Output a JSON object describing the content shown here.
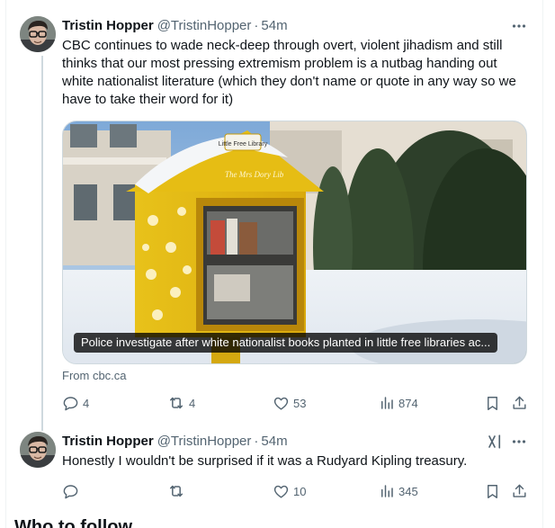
{
  "tweets": [
    {
      "name": "Tristin Hopper",
      "handle": "@TristinHopper",
      "separator": "·",
      "time": "54m",
      "text": "CBC continues to wade neck-deep through overt, violent jihadism and still thinks that our most pressing extremism problem is a nutbag handing out white nationalist literature (which they don't name or quote in any way so we have to take their word for it)",
      "card": {
        "caption": "Police investigate after white nationalist books planted in little free libraries ac...",
        "sign_text": "Little Free Library",
        "box_text": "The Mrs Dory Lib",
        "source": "From cbc.ca"
      },
      "actions": {
        "replies": "4",
        "reposts": "4",
        "likes": "53",
        "views": "874"
      }
    },
    {
      "name": "Tristin Hopper",
      "handle": "@TristinHopper",
      "separator": "·",
      "time": "54m",
      "text": "Honestly I wouldn't be surprised if it was a Rudyard Kipling treasury.",
      "actions": {
        "replies": "",
        "reposts": "",
        "likes": "10",
        "views": "345"
      }
    }
  ],
  "next_section": {
    "title": "Who to follow"
  },
  "colors": {
    "text": "#0f1419",
    "secondary": "#536471",
    "border": "#eff3f4",
    "thread": "#cfd9de"
  },
  "icons": [
    "more-horizontal-icon",
    "reply-icon",
    "repost-icon",
    "like-icon",
    "views-icon",
    "bookmark-icon",
    "share-icon",
    "grok-icon"
  ]
}
